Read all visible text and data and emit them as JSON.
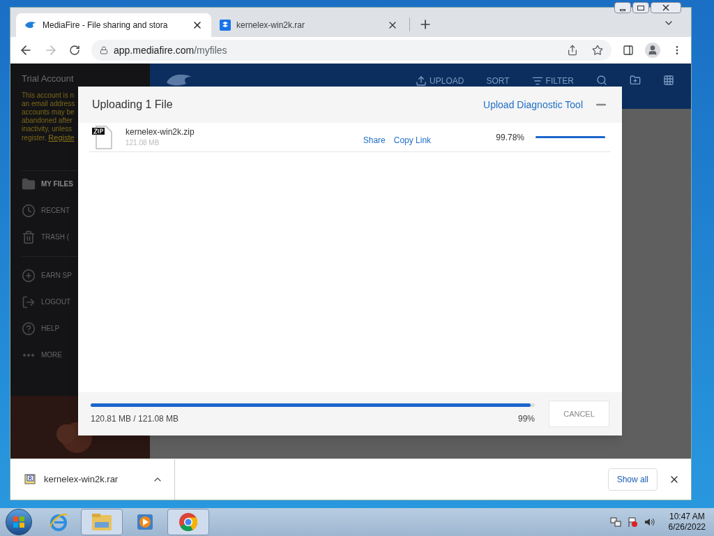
{
  "browser": {
    "tabs": [
      {
        "title": "MediaFire - File sharing and stora",
        "selected": true,
        "kind": "flame"
      },
      {
        "title": "kernelex-win2k.rar",
        "selected": false,
        "kind": "box"
      }
    ],
    "url_host": "app.mediafire.com",
    "url_path": "/myfiles"
  },
  "sidebar": {
    "title": "Trial Account",
    "notice_lines": [
      "This account is n",
      "an email address",
      "accounts may be",
      "abandoned after",
      "inactivity, unless"
    ],
    "notice_last": "register.",
    "register_link": "Registe",
    "items": [
      {
        "label": "MY FILES",
        "kind": "folder",
        "selected": true
      },
      {
        "label": "RECENT",
        "kind": "clock",
        "selected": false
      },
      {
        "label": "TRASH (",
        "kind": "trash",
        "selected": false
      },
      {
        "label": "EARN SP",
        "kind": "plus",
        "selected": false
      },
      {
        "label": "LOGOUT",
        "kind": "logout",
        "selected": false
      },
      {
        "label": "HELP",
        "kind": "help",
        "selected": false
      },
      {
        "label": "MORE",
        "kind": "more",
        "selected": false
      }
    ]
  },
  "toolbar": [
    "UPLOAD",
    "SORT",
    "FILTER"
  ],
  "dialog": {
    "title": "Uploading 1 File",
    "diagnostic_link": "Upload Diagnostic Tool",
    "files": [
      {
        "name": "kernelex-win2k.zip",
        "size": "121.08 MB",
        "share": "Share",
        "copy_link": "Copy Link",
        "percent": "99.78%",
        "level": 0.9978
      }
    ],
    "total": "120.81 MB / 121.08 MB",
    "total_percent": "99%",
    "level": 0.99,
    "cancel": "CANCEL"
  },
  "downloads": {
    "file": "kernelex-win2k.rar",
    "show_all": "Show all"
  },
  "taskbar": {
    "apps": [
      {
        "kind": "ie",
        "selected": false
      },
      {
        "kind": "explorer",
        "selected": true
      },
      {
        "kind": "media",
        "selected": false
      },
      {
        "kind": "chrome",
        "selected": true
      }
    ],
    "time": "10:47 AM",
    "date": "6/26/2022"
  }
}
